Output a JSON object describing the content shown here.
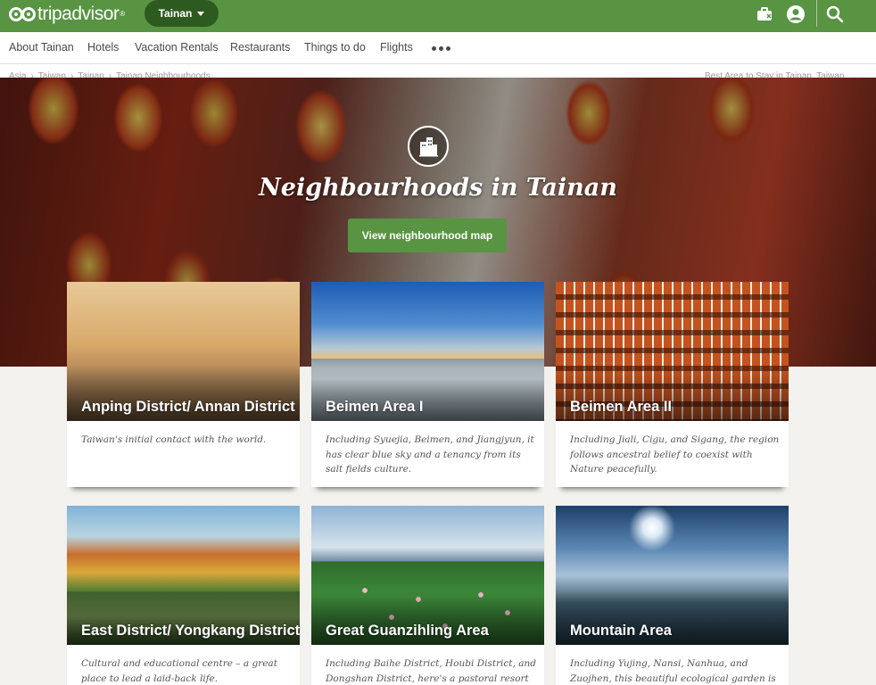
{
  "topbar": {
    "logo_text": "tripadvisor",
    "logo_reg": "®",
    "geo_label": "Tainan",
    "icons": [
      "trips-icon",
      "user-icon",
      "search-icon"
    ]
  },
  "subnav": {
    "items": [
      "About Tainan",
      "Hotels",
      "Vacation Rentals",
      "Restaurants",
      "Things to do",
      "Flights"
    ]
  },
  "breadcrumb": {
    "items": [
      "Asia",
      "Taiwan",
      "Tainan",
      "Tainan Neighbourhoods"
    ],
    "right_text": "Best Area to Stay in Tainan, Taiwan"
  },
  "hero": {
    "title": "Neighbourhoods in Tainan",
    "button_label": "View neighbourhood map"
  },
  "cards": [
    {
      "name": "Anping District/ Annan District",
      "description": "Taiwan's initial contact with the world."
    },
    {
      "name": "Beimen Area I",
      "description": "Including Syuejia, Beimen, and Jiangjyun, it has clear blue sky and a tenancy from its salt fields culture."
    },
    {
      "name": "Beimen Area II",
      "description": "Including Jiali, Cigu, and Sigang, the region follows ancestral belief to coexist with Nature peacefully."
    },
    {
      "name": "East District/ Yongkang District",
      "description": "Cultural and educational centre – a great place to lead a laid-back life."
    },
    {
      "name": "Great Guanzihling Area",
      "description": "Including Baihe District, Houbi District, and Dongshan District, here's a pastoral resort"
    },
    {
      "name": "Mountain Area",
      "description": "Including Yujing, Nansi, Nanhua, and Zuojhen, this beautiful ecological garden is"
    }
  ],
  "colors": {
    "brand_green": "#589442",
    "pill_green": "#2d5a1f"
  }
}
